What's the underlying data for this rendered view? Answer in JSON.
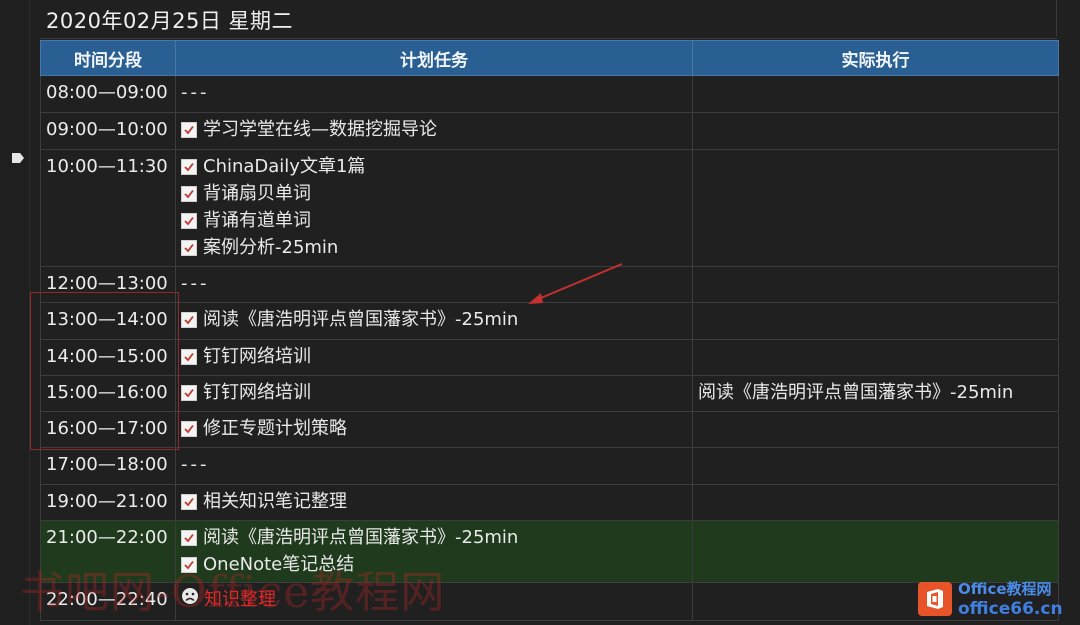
{
  "page": {
    "date_title": "2020年02月25日 星期二"
  },
  "table": {
    "headers": [
      "时间分段",
      "计划任务",
      "实际执行"
    ],
    "rows": [
      {
        "slot": "08:00—09:00",
        "tasks": [
          {
            "type": "dash",
            "text": "---"
          }
        ],
        "actual": ""
      },
      {
        "slot": "09:00—10:00",
        "tasks": [
          {
            "type": "check",
            "text": "学习学堂在线—数据挖掘导论"
          }
        ],
        "actual": ""
      },
      {
        "slot": "10:00—11:30",
        "tasks": [
          {
            "type": "check",
            "text": "ChinaDaily文章1篇"
          },
          {
            "type": "check",
            "text": "背诵扇贝单词"
          },
          {
            "type": "check",
            "text": "背诵有道单词"
          },
          {
            "type": "check",
            "text": "案例分析-25min"
          }
        ],
        "actual": ""
      },
      {
        "slot": "12:00—13:00",
        "tasks": [
          {
            "type": "dash",
            "text": "---"
          }
        ],
        "actual": ""
      },
      {
        "slot": "13:00—14:00",
        "tasks": [
          {
            "type": "check",
            "text": "阅读《唐浩明评点曾国藩家书》-25min"
          }
        ],
        "actual": ""
      },
      {
        "slot": "14:00—15:00",
        "tasks": [
          {
            "type": "check",
            "text": "钉钉网络培训"
          }
        ],
        "actual": ""
      },
      {
        "slot": "15:00—16:00",
        "tasks": [
          {
            "type": "check",
            "text": "钉钉网络培训"
          }
        ],
        "actual": "阅读《唐浩明评点曾国藩家书》-25min"
      },
      {
        "slot": "16:00—17:00",
        "tasks": [
          {
            "type": "check",
            "text": "修正专题计划策略"
          }
        ],
        "actual": ""
      },
      {
        "slot": "17:00—18:00",
        "tasks": [
          {
            "type": "dash",
            "text": "---"
          }
        ],
        "actual": ""
      },
      {
        "slot": "19:00—21:00",
        "tasks": [
          {
            "type": "check",
            "text": "相关知识笔记整理"
          }
        ],
        "actual": ""
      },
      {
        "slot": "21:00—22:00",
        "tasks": [
          {
            "type": "check",
            "text": "阅读《唐浩明评点曾国藩家书》-25min"
          },
          {
            "type": "check",
            "text": "OneNote笔记总结"
          }
        ],
        "actual": ""
      },
      {
        "slot": "22:00—22:40",
        "tasks": [
          {
            "type": "sad",
            "text": "知识整理"
          }
        ],
        "actual": ""
      }
    ]
  },
  "colors": {
    "header_bg": "#2a5f93",
    "highlight_row": "#1f3a1c",
    "missed_task": "#e02828",
    "annotation": "#c63030"
  },
  "watermark": {
    "text": "书吧网-Office教程网"
  },
  "logo": {
    "line1": "Office教程网",
    "line2": "office66.cn",
    "icon": "office-logo-icon"
  }
}
